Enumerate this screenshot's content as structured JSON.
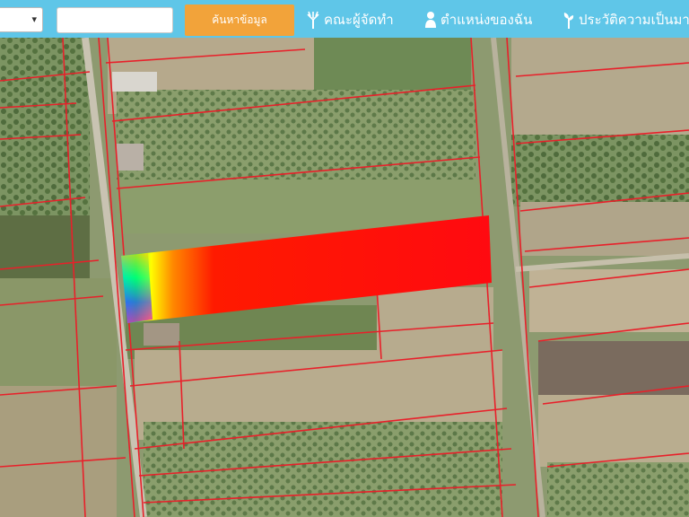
{
  "topbar": {
    "select_arrow": "▾",
    "search_placeholder": "",
    "search_button": "ค้นหาข้อมูล",
    "nav": [
      {
        "label": "คณะผู้จัดทำ",
        "icon": "tree-icon"
      },
      {
        "label": "ตำแหน่งของฉัน",
        "icon": "person-icon"
      },
      {
        "label": "ประวัติความเป็นมา",
        "icon": "plant-icon"
      }
    ]
  },
  "map": {
    "parcel_line_color": "#e8202a",
    "highlight_colors": [
      "#ff0000",
      "#ff8800",
      "#ffff00",
      "#00ff00",
      "#00ffff",
      "#0000ff",
      "#ff00ff"
    ]
  }
}
